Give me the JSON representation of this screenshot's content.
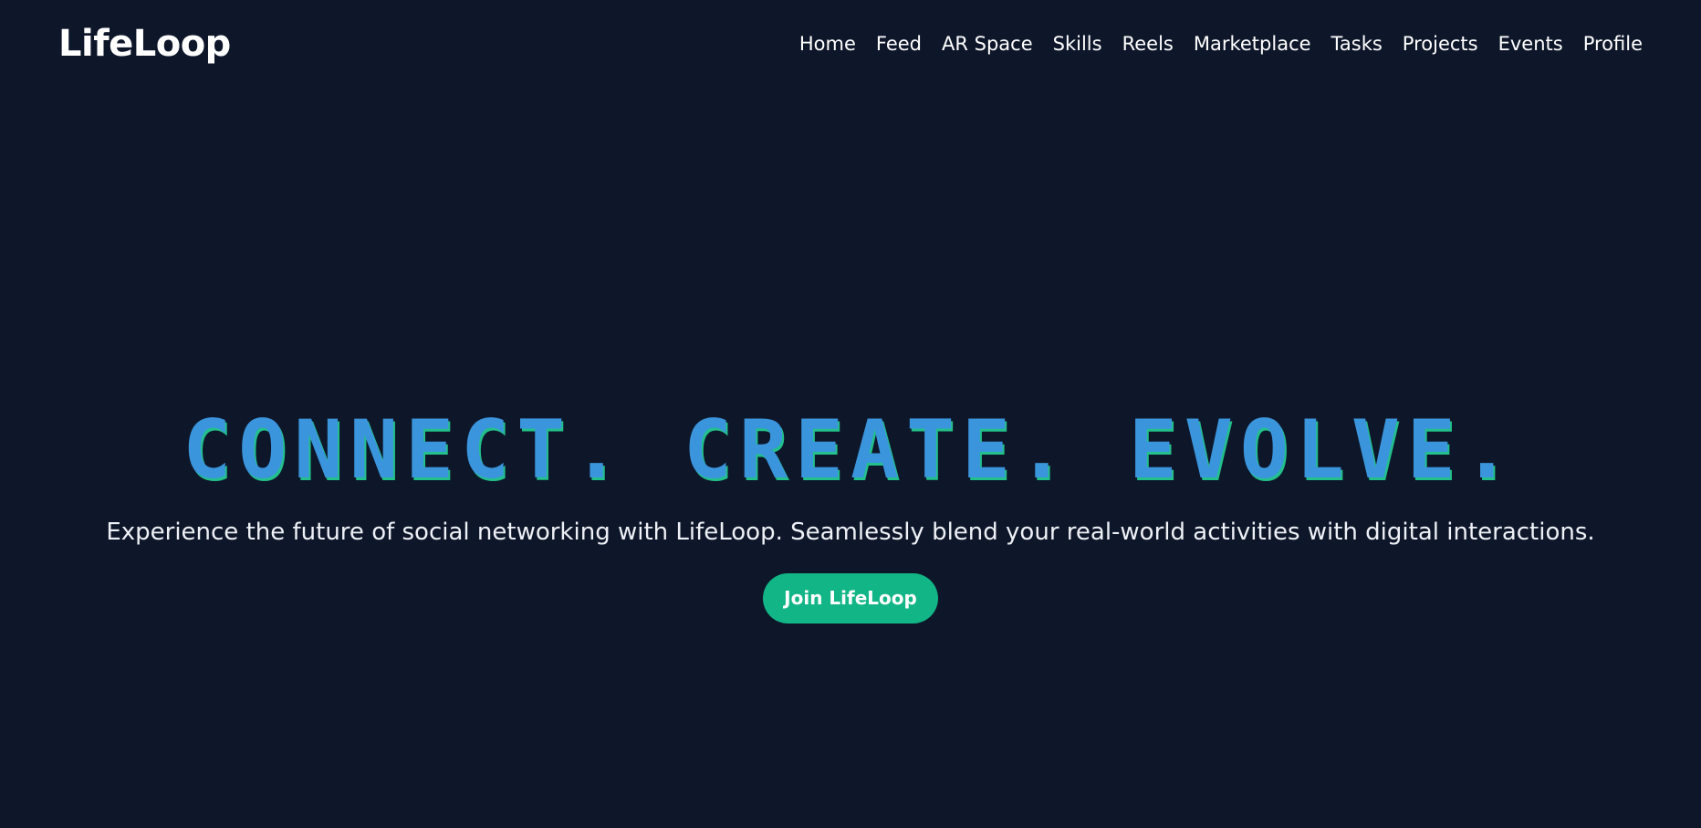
{
  "header": {
    "logo": "LifeLoop",
    "nav": [
      {
        "label": "Home"
      },
      {
        "label": "Feed"
      },
      {
        "label": "AR Space"
      },
      {
        "label": "Skills"
      },
      {
        "label": "Reels"
      },
      {
        "label": "Marketplace"
      },
      {
        "label": "Tasks"
      },
      {
        "label": "Projects"
      },
      {
        "label": "Events"
      },
      {
        "label": "Profile"
      }
    ]
  },
  "hero": {
    "title": "CONNECT. CREATE. EVOLVE.",
    "subtitle": "Experience the future of social networking with LifeLoop. Seamlessly blend your real-world activities with digital interactions.",
    "cta_label": "Join LifeLoop"
  },
  "colors": {
    "background": "#0e172a",
    "title": "#3b95dc",
    "title_shadow": "#22c08a",
    "cta": "#12b585",
    "text": "#ffffff"
  }
}
